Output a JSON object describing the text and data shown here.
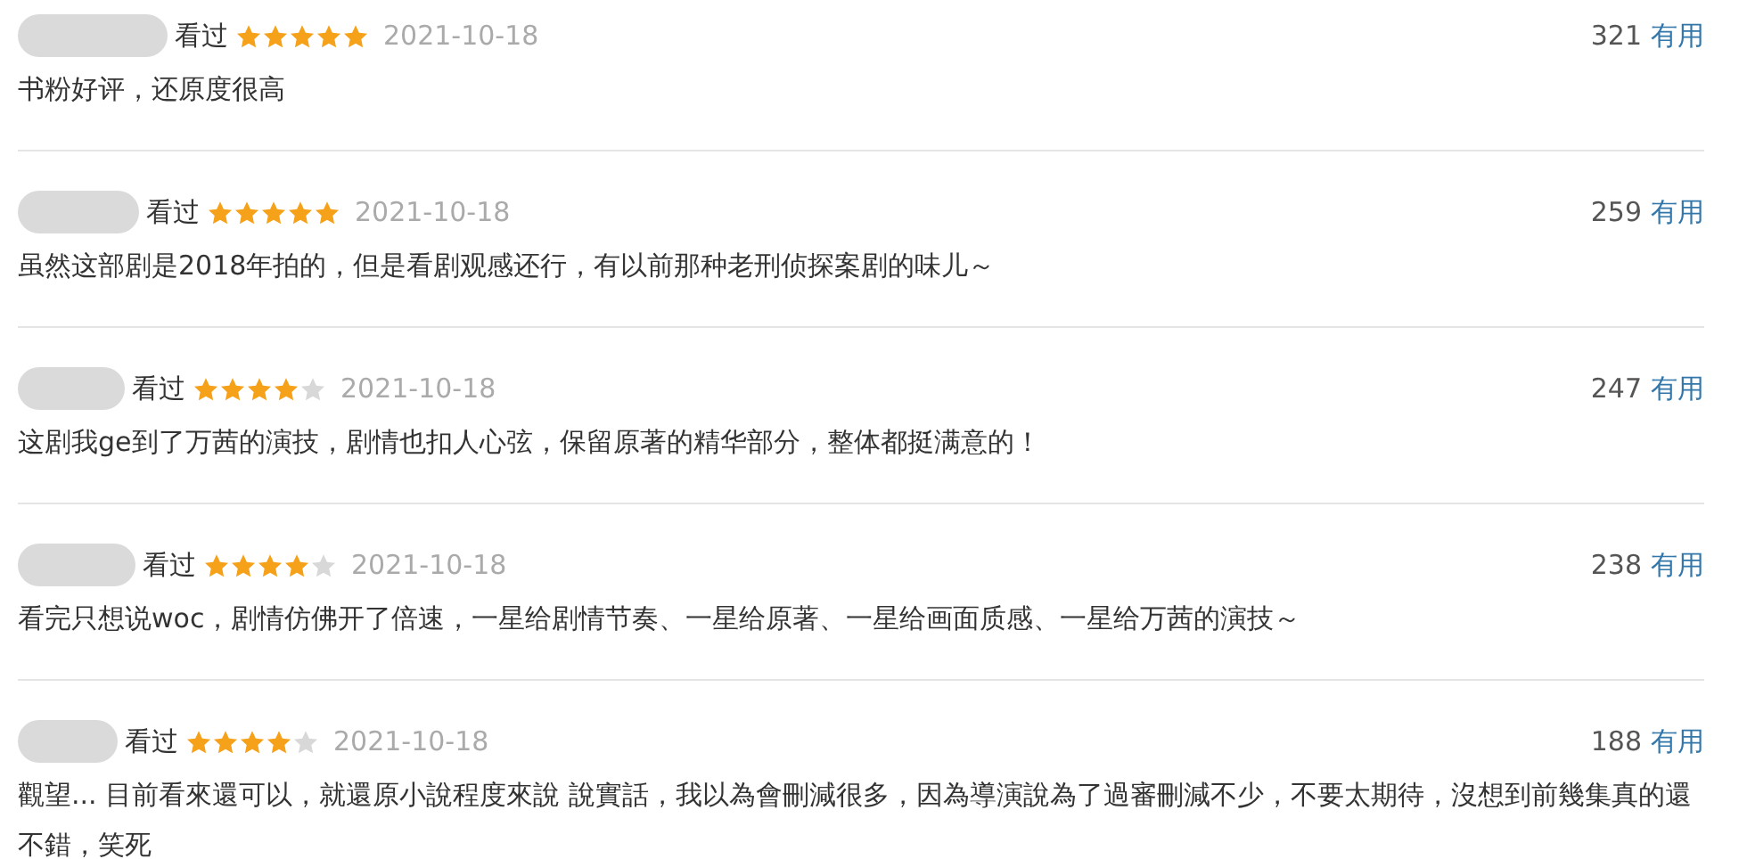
{
  "reviews": [
    {
      "status": "看过",
      "stars": 5,
      "date": "2021-10-18",
      "useful_count": "321",
      "useful_label": "有用",
      "text": "书粉好评，还原度很高"
    },
    {
      "status": "看过",
      "stars": 5,
      "date": "2021-10-18",
      "useful_count": "259",
      "useful_label": "有用",
      "text": "虽然这部剧是2018年拍的，但是看剧观感还行，有以前那种老刑侦探案剧的味儿～"
    },
    {
      "status": "看过",
      "stars": 4,
      "date": "2021-10-18",
      "useful_count": "247",
      "useful_label": "有用",
      "text": "这剧我ge到了万茜的演技，剧情也扣人心弦，保留原著的精华部分，整体都挺满意的！"
    },
    {
      "status": "看过",
      "stars": 4,
      "date": "2021-10-18",
      "useful_count": "238",
      "useful_label": "有用",
      "text": "看完只想说woc，剧情仿佛开了倍速，一星给剧情节奏、一星给原著、一星给画面质感、一星给万茜的演技～"
    },
    {
      "status": "看过",
      "stars": 4,
      "date": "2021-10-18",
      "useful_count": "188",
      "useful_label": "有用",
      "text": "觀望... 目前看來還可以，就還原小說程度來說 說實話，我以為會刪減很多，因為導演說為了過審刪減不少，不要太期待，沒想到前幾集真的還不錯，笑死"
    }
  ]
}
